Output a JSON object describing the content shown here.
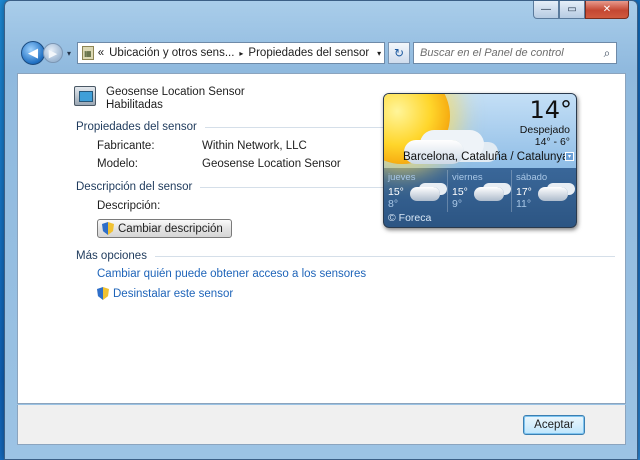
{
  "window": {
    "controls": {
      "minimize": "—",
      "maximize": "▭",
      "close": "✕"
    }
  },
  "nav": {
    "back_glyph": "◀",
    "forward_glyph": "▶",
    "address": {
      "prefix": "«",
      "segments": [
        "Ubicación y otros sens...",
        "Propiedades del sensor"
      ],
      "separator": "▸"
    },
    "refresh_glyph": "↻",
    "search_placeholder": "Buscar en el Panel de control",
    "search_glyph": "⌕"
  },
  "sensor": {
    "name": "Geosense Location Sensor",
    "state": "Habilitadas"
  },
  "properties": {
    "title": "Propiedades del sensor",
    "manufacturer_label": "Fabricante:",
    "manufacturer_value": "Within Network, LLC",
    "model_label": "Modelo:",
    "model_value": "Geosense Location Sensor"
  },
  "description": {
    "title": "Descripción del sensor",
    "label": "Descripción:",
    "change_button": "Cambiar descripción"
  },
  "more": {
    "title": "Más opciones",
    "access_link": "Cambiar quién puede obtener acceso a los sensores",
    "uninstall_link": "Desinstalar este sensor"
  },
  "weather": {
    "temperature": "14°",
    "condition": "Despejado",
    "range": "14° - 6°",
    "city": "Barcelona, Cataluña / Catalunya",
    "menu_glyph": "▾",
    "days": [
      {
        "name": "jueves",
        "high": "15°",
        "low": "8°"
      },
      {
        "name": "viernes",
        "high": "15°",
        "low": "9°"
      },
      {
        "name": "sábado",
        "high": "17°",
        "low": "11°"
      }
    ],
    "provider": "© Foreca"
  },
  "footer": {
    "ok_button": "Aceptar"
  }
}
